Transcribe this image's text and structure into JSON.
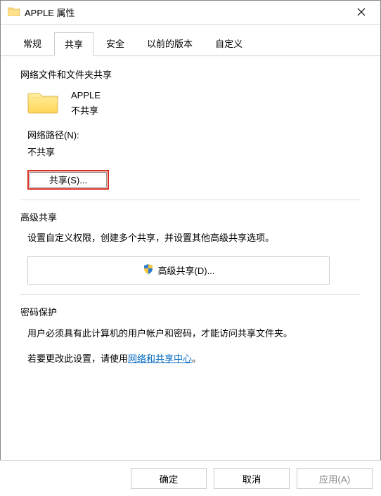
{
  "title": "APPLE 属性",
  "tabs": {
    "general": "常规",
    "share": "共享",
    "security": "安全",
    "previous": "以前的版本",
    "custom": "自定义"
  },
  "section1": {
    "title": "网络文件和文件夹共享",
    "folderName": "APPLE",
    "shareStatus": "不共享",
    "pathLabel": "网络路径(N):",
    "pathValue": "不共享",
    "shareButton": "共享(S)..."
  },
  "section2": {
    "title": "高级共享",
    "desc": "设置自定义权限，创建多个共享，并设置其他高级共享选项。",
    "button": "高级共享(D)..."
  },
  "section3": {
    "title": "密码保护",
    "desc": "用户必须具有此计算机的用户帐户和密码，才能访问共享文件夹。",
    "linkPrefix": "若要更改此设置，请使用",
    "linkText": "网络和共享中心",
    "linkSuffix": "。"
  },
  "footer": {
    "ok": "确定",
    "cancel": "取消",
    "apply": "应用(A)"
  }
}
